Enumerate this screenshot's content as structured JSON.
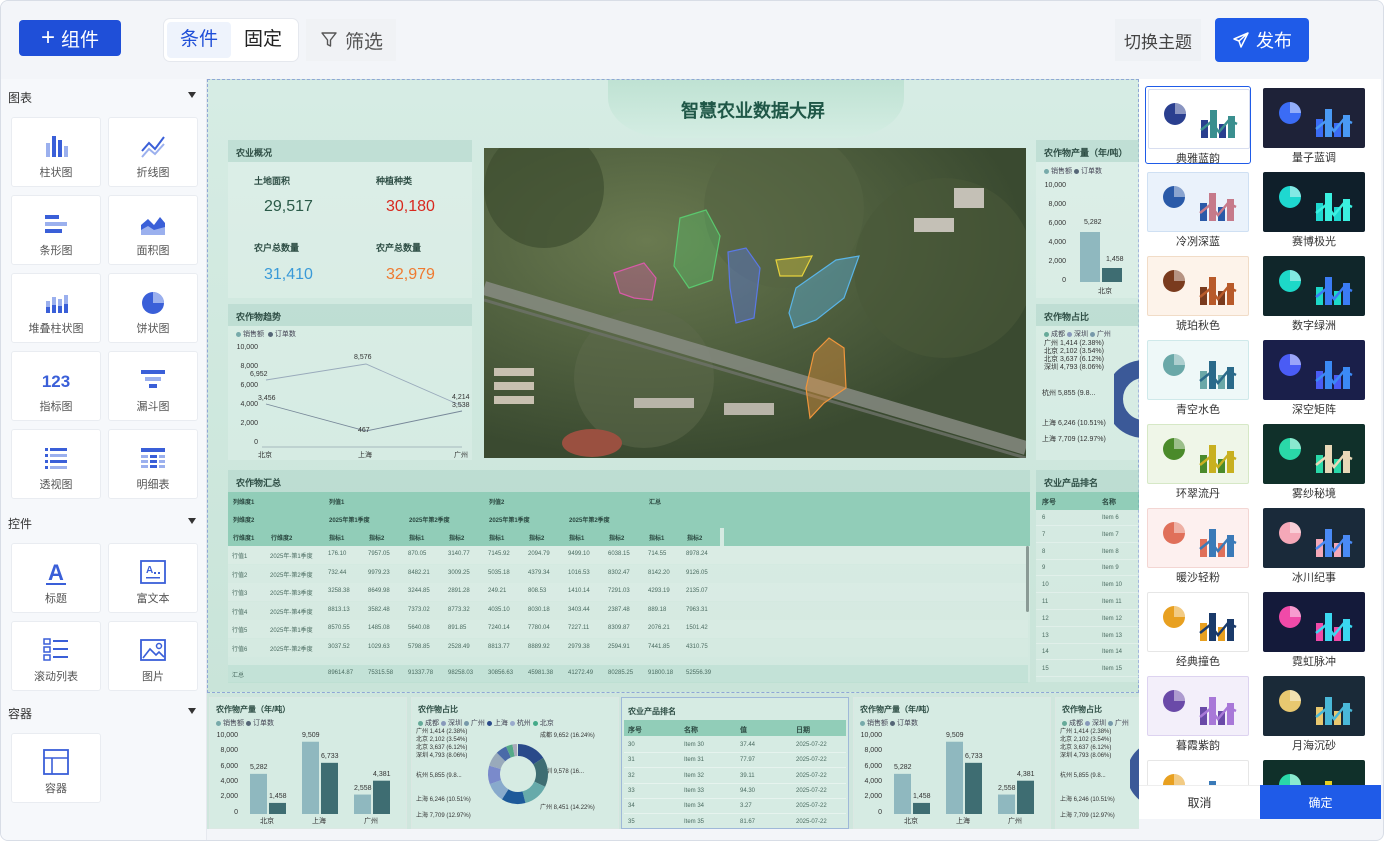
{
  "toolbar": {
    "add_label": "组件",
    "seg_condition": "条件",
    "seg_fixed": "固定",
    "filter_label": "筛选",
    "switch_theme": "切换主题",
    "publish": "发布"
  },
  "sidebar": {
    "charts_title": "图表",
    "charts": [
      {
        "label": "柱状图",
        "icon": "bar-chart-icon"
      },
      {
        "label": "折线图",
        "icon": "line-chart-icon"
      },
      {
        "label": "条形图",
        "icon": "hbar-chart-icon"
      },
      {
        "label": "面积图",
        "icon": "area-chart-icon"
      },
      {
        "label": "堆叠柱状图",
        "icon": "stacked-bar-icon"
      },
      {
        "label": "饼状图",
        "icon": "pie-chart-icon"
      },
      {
        "label": "指标图",
        "icon": "kpi-icon",
        "glyph": "123"
      },
      {
        "label": "漏斗图",
        "icon": "funnel-icon"
      },
      {
        "label": "透视图",
        "icon": "pivot-icon"
      },
      {
        "label": "明细表",
        "icon": "detail-table-icon"
      }
    ],
    "controls_title": "控件",
    "controls": [
      {
        "label": "标题",
        "icon": "title-icon"
      },
      {
        "label": "富文本",
        "icon": "rich-text-icon"
      },
      {
        "label": "滚动列表",
        "icon": "scroll-list-icon"
      },
      {
        "label": "图片",
        "icon": "image-icon"
      }
    ],
    "container_title": "容器",
    "containers": [
      {
        "label": "容器",
        "icon": "container-icon"
      }
    ]
  },
  "dashboard": {
    "title": "智慧农业数据大屏",
    "overview": {
      "title": "农业概况",
      "land_area_label": "土地面积",
      "land_area": "29,517",
      "crop_types_label": "种植种类",
      "crop_types": "30,180",
      "households_label": "农户总数量",
      "households": "31,410",
      "output_label": "农产总数量",
      "output": "32,979"
    },
    "trend": {
      "title": "农作物趋势",
      "legend": [
        "销售额",
        "订单数"
      ],
      "yticks": [
        "10,000",
        "8,000",
        "6,000",
        "4,000",
        "2,000",
        "0"
      ],
      "xticks": [
        "北京",
        "上海",
        "广州"
      ],
      "labels": [
        "6,952",
        "8,576",
        "3,456",
        "467",
        "4,214",
        "3,538"
      ]
    },
    "yield": {
      "title": "农作物产量（年/吨）",
      "legend": [
        "销售额",
        "订单数"
      ],
      "yticks": [
        "10,000",
        "8,000",
        "6,000",
        "4,000",
        "2,000",
        "0"
      ],
      "labels": [
        "5,282",
        "1,458"
      ],
      "xtick": "北京"
    },
    "share": {
      "title": "农作物占比",
      "legend": [
        "成都",
        "深圳",
        "广州"
      ],
      "labels": [
        "广州 1,414 (2.38%)",
        "北京 2,102 (3.54%)",
        "北京 3,637 (6.12%)",
        "深圳 4,793 (8.06%)",
        "杭州 5,855 (9.8...",
        "上海 6,246 (10.51%)",
        "上海 7,709 (12.97%)"
      ]
    },
    "summary": {
      "title": "农作物汇总",
      "h_row1": [
        "列维度1",
        "列值1",
        "列值2",
        "汇总"
      ],
      "h_row2": [
        "列维度2",
        "2025年第1季度",
        "2025年第2季度",
        "2025年第1季度",
        "2025年第2季度"
      ],
      "h_row3": [
        "行维度1",
        "行维度2",
        "指标1",
        "指标2",
        "指标1",
        "指标2",
        "指标1",
        "指标2",
        "指标1",
        "指标2",
        "指标1",
        "指标2"
      ],
      "rows": [
        [
          "行值1",
          "2025年-第1季度",
          "176.10",
          "7957.05",
          "870.05",
          "3140.77",
          "7145.92",
          "2094.79",
          "9499.10",
          "6038.15",
          "714.55",
          "8978.24"
        ],
        [
          "行值2",
          "2025年-第2季度",
          "732.44",
          "9979.23",
          "8482.21",
          "3009.25",
          "5035.18",
          "4379.34",
          "1016.53",
          "8302.47",
          "8142.20",
          "9126.05"
        ],
        [
          "行值3",
          "2025年-第3季度",
          "3258.38",
          "8649.98",
          "3244.85",
          "2891.28",
          "249.21",
          "808.53",
          "1410.14",
          "7291.03",
          "4293.19",
          "2135.07"
        ],
        [
          "行值4",
          "2025年-第4季度",
          "8813.13",
          "3582.48",
          "7373.02",
          "8773.32",
          "4035.10",
          "8030.18",
          "3403.44",
          "2387.48",
          "889.18",
          "7963.31"
        ],
        [
          "行值5",
          "2025年-第1季度",
          "8570.55",
          "1485.08",
          "5640.08",
          "891.85",
          "7240.14",
          "7780.04",
          "7227.11",
          "8309.87",
          "2076.21",
          "1501.42"
        ],
        [
          "行值6",
          "2025年-第2季度",
          "3037.52",
          "1029.63",
          "5798.85",
          "2528.49",
          "8813.77",
          "8889.92",
          "2979.38",
          "2594.91",
          "7441.85",
          "4310.75"
        ]
      ],
      "total": [
        "汇总",
        "",
        "89614.87",
        "75315.58",
        "91337.78",
        "98258.03",
        "30856.63",
        "45981.38",
        "41272.49",
        "80285.25",
        "91800.18",
        "52556.39"
      ]
    },
    "ranking": {
      "title": "农业产品排名",
      "headers": [
        "序号",
        "名称"
      ],
      "rows": [
        [
          "6",
          "Item 6"
        ],
        [
          "7",
          "Item 7"
        ],
        [
          "8",
          "Item 8"
        ],
        [
          "9",
          "Item 9"
        ],
        [
          "10",
          "Item 10"
        ],
        [
          "11",
          "Item 11"
        ],
        [
          "12",
          "Item 12"
        ],
        [
          "13",
          "Item 13"
        ],
        [
          "14",
          "Item 14"
        ],
        [
          "15",
          "Item 15"
        ]
      ]
    }
  },
  "bottom": {
    "yield1": {
      "title": "农作物产量（年/吨）",
      "legend": [
        "销售额",
        "订单数"
      ],
      "yticks": [
        "10,000",
        "8,000",
        "6,000",
        "4,000",
        "2,000",
        "0"
      ],
      "xticks": [
        "北京",
        "上海",
        "广州"
      ],
      "labels": [
        "5,282",
        "1,458",
        "9,509",
        "6,733",
        "2,558",
        "4,381"
      ]
    },
    "share1": {
      "title": "农作物占比",
      "legend": [
        "成都",
        "深圳",
        "广州",
        "上海",
        "杭州",
        "北京"
      ],
      "labels": [
        "广州 1,414 (2.38%)",
        "北京 2,102 (3.54%)",
        "北京 3,637 (6.12%)",
        "深圳 4,793 (8.06%)",
        "杭州 5,855 (9.8...",
        "上海 6,246 (10.51%)",
        "上海 7,709 (12.97%)",
        "成都 9,652 (16.24%)",
        "深圳 9,578 (16...",
        "广州 8,451 (14.22%)"
      ]
    },
    "rank": {
      "title": "农业产品排名",
      "headers": [
        "序号",
        "名称",
        "值",
        "日期"
      ],
      "rows": [
        [
          "30",
          "Item 30",
          "37.44",
          "2025-07-22"
        ],
        [
          "31",
          "Item 31",
          "77.97",
          "2025-07-22"
        ],
        [
          "32",
          "Item 32",
          "39.11",
          "2025-07-22"
        ],
        [
          "33",
          "Item 33",
          "94.30",
          "2025-07-22"
        ],
        [
          "34",
          "Item 34",
          "3.27",
          "2025-07-22"
        ],
        [
          "35",
          "Item 35",
          "81.67",
          "2025-07-22"
        ]
      ]
    },
    "yield2": {
      "title": "农作物产量（年/吨）",
      "legend": [
        "销售额",
        "订单数"
      ],
      "yticks": [
        "10,000",
        "8,000",
        "6,000",
        "4,000",
        "2,000",
        "0"
      ],
      "xticks": [
        "北京",
        "上海",
        "广州"
      ],
      "labels": [
        "5,282",
        "1,458",
        "9,509",
        "6,733",
        "2,558",
        "4,381"
      ]
    },
    "share2": {
      "title": "农作物占比",
      "legend": [
        "成都",
        "深圳",
        "广州"
      ],
      "labels": [
        "广州 1,414 (2.38%)",
        "北京 2,102 (3.54%)",
        "北京 3,637 (6.12%)",
        "深圳 4,793 (8.06%)",
        "杭州 5,855 (9.8...",
        "上海 6,246 (10.51%)",
        "上海 7,709 (12.97%)"
      ]
    }
  },
  "themes": [
    {
      "name": "典雅蓝韵",
      "bg": "#ffffff",
      "border": "#d8def0",
      "c1": "#2a3f8f",
      "c2": "#3a8f8f",
      "selected": true
    },
    {
      "name": "量子蓝调",
      "bg": "#1e2238",
      "border": "#1e2238",
      "c1": "#3b6cf5",
      "c2": "#4a9af5",
      "selected": false
    },
    {
      "name": "冷冽深蓝",
      "bg": "#eaf2fb",
      "border": "#cfe0f3",
      "c1": "#2a5aa8",
      "c2": "#c67a8a",
      "selected": false
    },
    {
      "name": "赛博极光",
      "bg": "#0f1f2a",
      "border": "#0f1f2a",
      "c1": "#1ed8d0",
      "c2": "#3bf0e0",
      "selected": false
    },
    {
      "name": "琥珀秋色",
      "bg": "#fdf3ea",
      "border": "#f1dcc7",
      "c1": "#7a3b1e",
      "c2": "#b85a2a",
      "selected": false
    },
    {
      "name": "数字绿洲",
      "bg": "#10262a",
      "border": "#10262a",
      "c1": "#1dd8c8",
      "c2": "#3b7cf5",
      "selected": false
    },
    {
      "name": "青空水色",
      "bg": "#eef8f8",
      "border": "#cfe9ea",
      "c1": "#6aa8a8",
      "c2": "#2a6a8a",
      "selected": false
    },
    {
      "name": "深空矩阵",
      "bg": "#1a1f4a",
      "border": "#1a1f4a",
      "c1": "#4a5cf5",
      "c2": "#3b8af5",
      "selected": false
    },
    {
      "name": "环翠流丹",
      "bg": "#eff6e8",
      "border": "#d6e8c6",
      "c1": "#4a8a2a",
      "c2": "#c8b020",
      "selected": false
    },
    {
      "name": "雾纱秘境",
      "bg": "#10302a",
      "border": "#10302a",
      "c1": "#2ad8a8",
      "c2": "#e8d8b8",
      "selected": false
    },
    {
      "name": "暖沙轻粉",
      "bg": "#fdf0ef",
      "border": "#f3d6d3",
      "c1": "#e0705a",
      "c2": "#3a7ab8",
      "selected": false
    },
    {
      "name": "冰川纪事",
      "bg": "#1a2a3a",
      "border": "#1a2a3a",
      "c1": "#f5a8b8",
      "c2": "#4a8af5",
      "selected": false
    },
    {
      "name": "经典撞色",
      "bg": "#ffffff",
      "border": "#e6e6e6",
      "c1": "#e8a020",
      "c2": "#1a3a6a",
      "selected": false
    },
    {
      "name": "霓虹脉冲",
      "bg": "#141a3a",
      "border": "#141a3a",
      "c1": "#f04aa8",
      "c2": "#3bd8f0",
      "selected": false
    },
    {
      "name": "暮霞紫韵",
      "bg": "#f3effa",
      "border": "#ddd3f0",
      "c1": "#6a4aa8",
      "c2": "#a878d8",
      "selected": false
    },
    {
      "name": "月海沉砂",
      "bg": "#1a2a38",
      "border": "#1a2a38",
      "c1": "#e8c870",
      "c2": "#4ab8d8",
      "selected": false
    },
    {
      "name": "",
      "bg": "#ffffff",
      "border": "#e6e6e6",
      "c1": "#e8a020",
      "c2": "#3a7ab8",
      "selected": false
    },
    {
      "name": "",
      "bg": "#10302a",
      "border": "#10302a",
      "c1": "#2ad8a8",
      "c2": "#e8d020",
      "selected": false
    }
  ],
  "dialog": {
    "cancel": "取消",
    "confirm": "确定"
  }
}
